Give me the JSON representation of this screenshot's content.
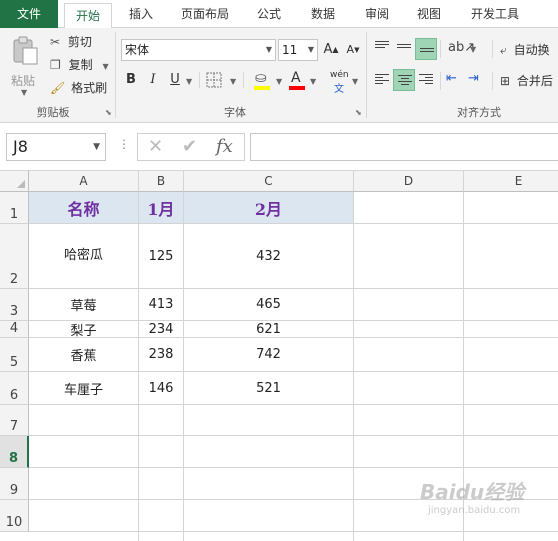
{
  "tabs": [
    {
      "label": "文件"
    },
    {
      "label": "开始"
    },
    {
      "label": "插入"
    },
    {
      "label": "页面布局"
    },
    {
      "label": "公式"
    },
    {
      "label": "数据"
    },
    {
      "label": "审阅"
    },
    {
      "label": "视图"
    },
    {
      "label": "开发工具"
    }
  ],
  "ribbon": {
    "clipboard": {
      "paste_label": "粘贴",
      "cut_label": "剪切",
      "copy_label": "复制",
      "format_painter_label": "格式刷",
      "group_label": "剪贴板"
    },
    "font": {
      "font_name": "宋体",
      "font_size": "11",
      "bold_label": "B",
      "italic_label": "I",
      "underline_label": "U",
      "grow_label": "A",
      "shrink_label": "A",
      "font_color_label": "A",
      "phonetic_label": "wén",
      "group_label": "字体",
      "fill_color": "#ffff00",
      "font_color": "#ff0000"
    },
    "alignment": {
      "wrap_text_label": "自动换",
      "merge_label": "合并后",
      "group_label": "对齐方式"
    }
  },
  "formula_bar": {
    "name_box": "J8",
    "cancel_icon": "✕",
    "enter_icon": "✔",
    "fx_label": "fx",
    "formula": ""
  },
  "columns": [
    "A",
    "B",
    "C",
    "D",
    "E"
  ],
  "rows": [
    "1",
    "2",
    "3",
    "4",
    "5",
    "6",
    "7",
    "8",
    "9",
    "10"
  ],
  "selected_row": "8",
  "sheet": {
    "header": {
      "a": "名称",
      "b": "1月",
      "c": "2月"
    },
    "data": [
      {
        "a": "哈密瓜",
        "b": "125",
        "c": "432"
      },
      {
        "a": "草莓",
        "b": "413",
        "c": "465"
      },
      {
        "a": "梨子",
        "b": "234",
        "c": "621"
      },
      {
        "a": "香蕉",
        "b": "238",
        "c": "742"
      },
      {
        "a": "车厘子",
        "b": "146",
        "c": "521"
      }
    ]
  },
  "colors": {
    "accent": "#217346",
    "header_fill": "#dce6f1",
    "header_text": "#7030a0",
    "align_active": "#9fd5b5"
  },
  "watermark": {
    "text": "Baidu经验",
    "sub": "jingyan.baidu.com"
  }
}
